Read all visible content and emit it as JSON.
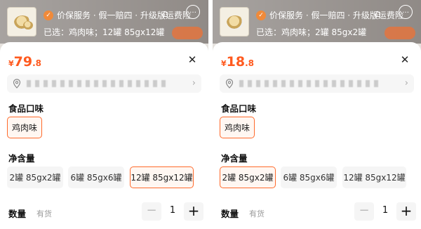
{
  "panels": [
    {
      "service_text": "价保服务 · 假一赔四 · 升级版运费险",
      "selected_text": "已选：鸡肉味；12罐 85gx12罐",
      "price": {
        "currency": "¥",
        "integer": "79",
        "decimal": ".8"
      },
      "flavor_title": "食品口味",
      "flavor_options": [
        "鸡肉味"
      ],
      "flavor_selected_index": 0,
      "size_title": "净含量",
      "size_options": [
        "2罐 85gx2罐",
        "6罐 85gx6罐",
        "12罐 85gx12罐"
      ],
      "size_selected_index": 2,
      "quantity_label": "数量",
      "stock_text": "有货",
      "quantity": "1"
    },
    {
      "service_text": "价保服务 · 假一赔四 · 升级版运费险",
      "selected_text": "已选：鸡肉味；2罐 85gx2罐",
      "price": {
        "currency": "¥",
        "integer": "18",
        "decimal": ".8"
      },
      "flavor_title": "食品口味",
      "flavor_options": [
        "鸡肉味"
      ],
      "flavor_selected_index": 0,
      "size_title": "净含量",
      "size_options": [
        "2罐 85gx2罐",
        "6罐 85gx6罐",
        "12罐 85gx12罐"
      ],
      "size_selected_index": 0,
      "quantity_label": "数量",
      "stock_text": "有货",
      "quantity": "1"
    }
  ],
  "icons": {
    "shield": "shield-check-icon",
    "close": "close-icon",
    "location": "location-pin-icon",
    "chevron": "chevron-right-icon",
    "minus": "minus-icon",
    "plus": "plus-icon",
    "cart": "cart-icon",
    "more": "more-icon"
  },
  "colors": {
    "accent": "#ff5a1f",
    "selected_border": "#ff6a2b",
    "chip_bg": "#f5f5f5"
  }
}
